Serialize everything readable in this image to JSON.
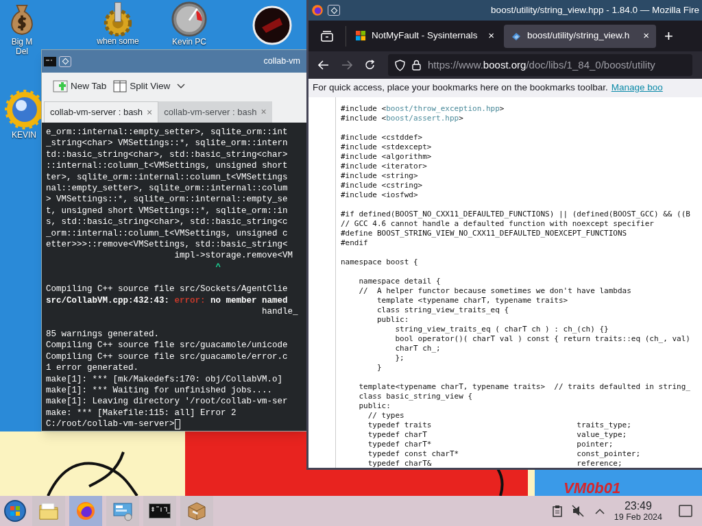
{
  "desktop_icons": [
    {
      "kind": "money-bag",
      "label_lines": [
        "Big M",
        "Del"
      ]
    },
    {
      "kind": "gear",
      "label_lines": [
        "when some"
      ]
    },
    {
      "kind": "gauge",
      "label_lines": [
        "Kevin PC"
      ]
    },
    {
      "kind": "dark-disc"
    },
    {
      "kind": "sun-globe",
      "label_lines": [
        "KEVIN"
      ]
    }
  ],
  "terminal": {
    "title": "collab-vm",
    "toolbar": [
      {
        "kind": "new-tab",
        "label": "New Tab"
      },
      {
        "kind": "split-view",
        "label": "Split View"
      }
    ],
    "tabs": [
      {
        "label": "collab-vm-server : bash",
        "close": "×",
        "selected": true
      },
      {
        "label": "collab-vm-server : bash",
        "close": "×",
        "selected": false
      }
    ],
    "lines": [
      {
        "kind": "plain",
        "text": "e_orm::internal::empty_setter>, sqlite_orm::int"
      },
      {
        "kind": "plain",
        "text": "_string<char> VMSettings::*, sqlite_orm::intern"
      },
      {
        "kind": "plain",
        "text": "td::basic_string<char>, std::basic_string<char>"
      },
      {
        "kind": "plain",
        "text": "::internal::column_t<VMSettings, unsigned short"
      },
      {
        "kind": "plain",
        "text": "ter>, sqlite_orm::internal::column_t<VMSettings"
      },
      {
        "kind": "plain",
        "text": "nal::empty_setter>, sqlite_orm::internal::colum"
      },
      {
        "kind": "plain",
        "text": "> VMSettings::*, sqlite_orm::internal::empty_se"
      },
      {
        "kind": "plain",
        "text": "t, unsigned short VMSettings::*, sqlite_orm::in"
      },
      {
        "kind": "plain",
        "text": "s, std::basic_string<char>, std::basic_string<c"
      },
      {
        "kind": "plain",
        "text": "_orm::internal::column_t<VMSettings, unsigned c"
      },
      {
        "kind": "plain",
        "text": "etter>>>::remove<VMSettings, std::basic_string<"
      },
      {
        "kind": "plain",
        "text": "                         impl->storage.remove<VM"
      },
      {
        "kind": "caret",
        "text": "                                 ^"
      },
      {
        "kind": "blank"
      },
      {
        "kind": "plain",
        "text": "Compiling C++ source file src/Sockets/AgentClie"
      },
      {
        "kind": "error",
        "path": "src/CollabVM.cpp:432:43:",
        "label": "error:",
        "message": "no member named"
      },
      {
        "kind": "plain",
        "text": "                                          handle_"
      },
      {
        "kind": "blank"
      },
      {
        "kind": "plain",
        "text": "85 warnings generated."
      },
      {
        "kind": "plain",
        "text": "Compiling C++ source file src/guacamole/unicode"
      },
      {
        "kind": "plain",
        "text": "Compiling C++ source file src/guacamole/error.c"
      },
      {
        "kind": "plain",
        "text": "1 error generated."
      },
      {
        "kind": "plain",
        "text": "make[1]: *** [mk/Makedefs:170: obj/CollabVM.o]"
      },
      {
        "kind": "plain",
        "text": "make[1]: *** Waiting for unfinished jobs...."
      },
      {
        "kind": "plain",
        "text": "make[1]: Leaving directory '/root/collab-vm-ser"
      },
      {
        "kind": "plain",
        "text": "make: *** [Makefile:115: all] Error 2"
      },
      {
        "kind": "prompt",
        "text": "C:/root/collab-vm-server>"
      }
    ]
  },
  "browser": {
    "title": "boost/utility/string_view.hpp - 1.84.0 — Mozilla Fire",
    "tabs": [
      {
        "kind": "microsoft",
        "title": "NotMyFault - Sysinternals",
        "close": "×",
        "selected": false
      },
      {
        "kind": "boost",
        "title": "boost/utility/string_view.h",
        "close": "×",
        "selected": true
      }
    ],
    "new_tab": "+",
    "url": {
      "prefix": "https://www.",
      "domain": "boost.org",
      "path": "/doc/libs/1_84_0/boost/utility"
    },
    "bookmarks_hint": {
      "text": "For quick access, place your bookmarks here on the bookmarks toolbar.",
      "link": "Manage boo"
    },
    "code": [
      {
        "kind": "include",
        "before": "#include <",
        "path": "boost/throw_exception.hpp",
        "after": ">"
      },
      {
        "kind": "include",
        "before": "#include <",
        "path": "boost/assert.hpp",
        "after": ">"
      },
      {
        "kind": "blank"
      },
      {
        "kind": "plain",
        "text": "#include <cstddef>"
      },
      {
        "kind": "plain",
        "text": "#include <stdexcept>"
      },
      {
        "kind": "plain",
        "text": "#include <algorithm>"
      },
      {
        "kind": "plain",
        "text": "#include <iterator>"
      },
      {
        "kind": "plain",
        "text": "#include <string>"
      },
      {
        "kind": "plain",
        "text": "#include <cstring>"
      },
      {
        "kind": "plain",
        "text": "#include <iosfwd>"
      },
      {
        "kind": "blank"
      },
      {
        "kind": "plain",
        "text": "#if defined(BOOST_NO_CXX11_DEFAULTED_FUNCTIONS) || (defined(BOOST_GCC) && ((B"
      },
      {
        "kind": "plain",
        "text": "// GCC 4.6 cannot handle a defaulted function with noexcept specifier"
      },
      {
        "kind": "plain",
        "text": "#define BOOST_STRING_VIEW_NO_CXX11_DEFAULTED_NOEXCEPT_FUNCTIONS"
      },
      {
        "kind": "plain",
        "text": "#endif"
      },
      {
        "kind": "blank"
      },
      {
        "kind": "plain",
        "text": "namespace boost {"
      },
      {
        "kind": "blank"
      },
      {
        "kind": "plain",
        "text": "    namespace detail {"
      },
      {
        "kind": "plain",
        "text": "    //  A helper functor because sometimes we don't have lambdas"
      },
      {
        "kind": "plain",
        "text": "        template <typename charT, typename traits>"
      },
      {
        "kind": "plain",
        "text": "        class string_view_traits_eq {"
      },
      {
        "kind": "plain",
        "text": "        public:"
      },
      {
        "kind": "plain",
        "text": "            string_view_traits_eq ( charT ch ) : ch_(ch) {}"
      },
      {
        "kind": "plain",
        "text": "            bool operator()( charT val ) const { return traits::eq (ch_, val)"
      },
      {
        "kind": "plain",
        "text": "            charT ch_;"
      },
      {
        "kind": "plain",
        "text": "            };"
      },
      {
        "kind": "plain",
        "text": "        }"
      },
      {
        "kind": "blank"
      },
      {
        "kind": "plain",
        "text": "    template<typename charT, typename traits>  // traits defaulted in string_"
      },
      {
        "kind": "plain",
        "text": "    class basic_string_view {"
      },
      {
        "kind": "plain",
        "text": "    public:"
      },
      {
        "kind": "plain",
        "text": "      // types"
      },
      {
        "kind": "plain",
        "text": "      typedef traits                                traits_type;"
      },
      {
        "kind": "plain",
        "text": "      typedef charT                                 value_type;"
      },
      {
        "kind": "plain",
        "text": "      typedef charT*                                pointer;"
      },
      {
        "kind": "plain",
        "text": "      typedef const charT*                          const_pointer;"
      },
      {
        "kind": "plain",
        "text": "      typedef charT&                                reference;"
      }
    ]
  },
  "wallpaper_text": "VM0b01",
  "taskbar": {
    "apps": [
      {
        "kind": "folder",
        "selected": false
      },
      {
        "kind": "firefox",
        "selected": true
      },
      {
        "kind": "control-panel",
        "selected": false
      },
      {
        "kind": "terminal",
        "selected": false
      },
      {
        "kind": "package",
        "selected": false
      }
    ],
    "muted": true,
    "clock": {
      "time": "23:49",
      "date": "19 Feb 2024"
    }
  }
}
